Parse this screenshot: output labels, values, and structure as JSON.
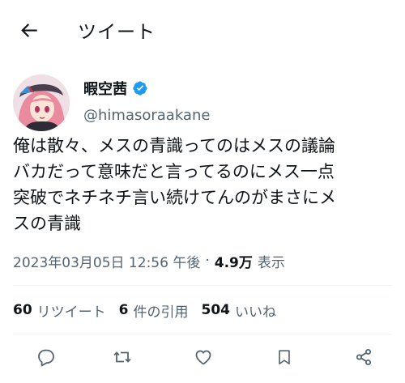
{
  "header": {
    "title": "ツイート",
    "back_icon": "arrow-left-icon"
  },
  "author": {
    "display_name": "暇空茜",
    "handle": "@himasoraakane",
    "verified": true,
    "verified_color": "#1d9bf0"
  },
  "tweet": {
    "lines": [
      "俺は散々、メスの青識ってのはメスの議論",
      "バカだって意味だと言ってるのにメス一点",
      "突破でネチネチ言い続けてんのがまさにメ",
      "スの青識"
    ]
  },
  "meta": {
    "timestamp": "2023年03月05日 12:56 午後",
    "separator": "·",
    "views_count": "4.9万",
    "views_label": "表示"
  },
  "stats": {
    "retweets_count": "60",
    "retweets_label": "リツイート",
    "quotes_count": "6",
    "quotes_label": "件の引用",
    "likes_count": "504",
    "likes_label": "いいね"
  },
  "actions": {
    "reply_icon": "reply-icon",
    "retweet_icon": "retweet-icon",
    "like_icon": "heart-icon",
    "bookmark_icon": "bookmark-icon",
    "share_icon": "share-icon",
    "icon_color": "#536471"
  }
}
